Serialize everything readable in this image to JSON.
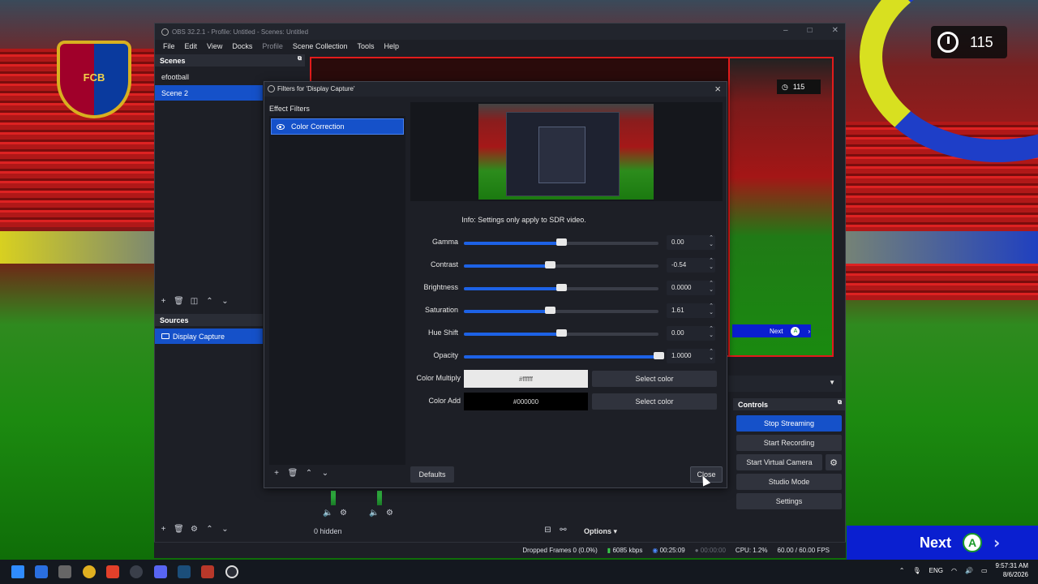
{
  "background": {
    "badge_text": "FCB",
    "timer_value": "115",
    "next_label": "Next",
    "next_button_letter": "A"
  },
  "window": {
    "title": "OBS 32.2.1 - Profile: Untitled - Scenes: Untitled"
  },
  "menu": [
    "File",
    "Edit",
    "View",
    "Docks",
    "Profile",
    "Scene Collection",
    "Tools",
    "Help"
  ],
  "scenes": {
    "title": "Scenes",
    "items": [
      "efootball",
      "Scene 2"
    ],
    "selected": "Scene 2"
  },
  "sources": {
    "title": "Sources",
    "items": [
      "Display Capture"
    ]
  },
  "preview": {
    "timer_value": "115",
    "next_label": "Next",
    "next_button_letter": "A"
  },
  "dialog": {
    "title": "Filters for 'Display Capture'",
    "effect_filters_label": "Effect Filters",
    "filters": [
      "Color Correction"
    ],
    "info": "Info: Settings only apply to SDR video.",
    "properties": [
      {
        "label": "Gamma",
        "value": "0.00",
        "slider": 0.5
      },
      {
        "label": "Contrast",
        "value": "-0.54",
        "slider": 0.44
      },
      {
        "label": "Brightness",
        "value": "0.0000",
        "slider": 0.5
      },
      {
        "label": "Saturation",
        "value": "1.61",
        "slider": 0.44
      },
      {
        "label": "Hue Shift",
        "value": "0.00",
        "slider": 0.5
      },
      {
        "label": "Opacity",
        "value": "1.0000",
        "slider": 1.0
      }
    ],
    "color_multiply": {
      "label": "Color Multiply",
      "value": "#ffffff",
      "button": "Select color"
    },
    "color_add": {
      "label": "Color Add",
      "value": "#000000",
      "button": "Select color"
    },
    "defaults_label": "Defaults",
    "close_label": "Close"
  },
  "controls": {
    "title": "Controls",
    "buttons": [
      "Stop Streaming",
      "Start Recording",
      "Start Virtual Camera",
      "Studio Mode",
      "Settings"
    ]
  },
  "mixer": {
    "hidden_label": "0 hidden",
    "options_label": "Options"
  },
  "status": {
    "dropped": "Dropped Frames 0 (0.0%)",
    "bitrate": "6085 kbps",
    "stream_time": "00:25:09",
    "rec_time": "00:00:00",
    "cpu": "CPU: 1.2%",
    "fps": "60.00 / 60.00 FPS"
  },
  "taskbar": {
    "lang": "ENG",
    "time": "9:57:31 AM",
    "date": "8/6/2026"
  },
  "colors": {
    "accent": "#1551c9",
    "preview_border": "#e21b1b"
  }
}
